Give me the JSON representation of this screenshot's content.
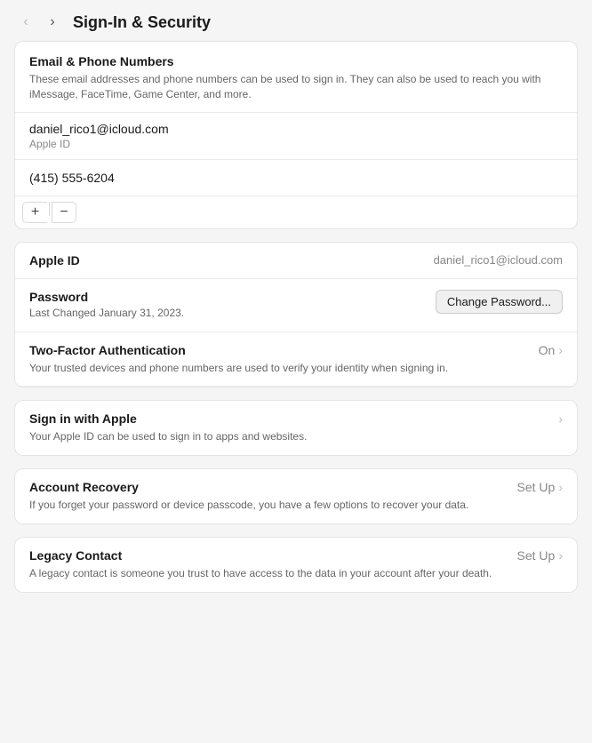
{
  "header": {
    "title": "Sign-In & Security",
    "back_label": "‹",
    "forward_label": "›"
  },
  "email_phone_card": {
    "title": "Email & Phone Numbers",
    "description": "These email addresses and phone numbers can be used to sign in. They can also be used to reach you with iMessage, FaceTime, Game Center, and more.",
    "email": "daniel_rico1@icloud.com",
    "email_type": "Apple ID",
    "phone": "(415) 555-6204",
    "add_label": "+",
    "remove_label": "−"
  },
  "settings_card": {
    "apple_id_label": "Apple ID",
    "apple_id_value": "daniel_rico1@icloud.com",
    "password_label": "Password",
    "password_sublabel": "Last Changed January 31, 2023.",
    "change_password_btn": "Change Password...",
    "two_factor_label": "Two-Factor Authentication",
    "two_factor_status": "On",
    "two_factor_desc": "Your trusted devices and phone numbers are used to verify your identity when signing in."
  },
  "sign_in_apple_card": {
    "label": "Sign in with Apple",
    "description": "Your Apple ID can be used to sign in to apps and websites."
  },
  "account_recovery_card": {
    "label": "Account Recovery",
    "action": "Set Up",
    "description": "If you forget your password or device passcode, you have a few options to recover your data."
  },
  "legacy_contact_card": {
    "label": "Legacy Contact",
    "action": "Set Up",
    "description": "A legacy contact is someone you trust to have access to the data in your account after your death."
  },
  "icons": {
    "chevron": "›",
    "back": "‹",
    "forward": "›"
  }
}
